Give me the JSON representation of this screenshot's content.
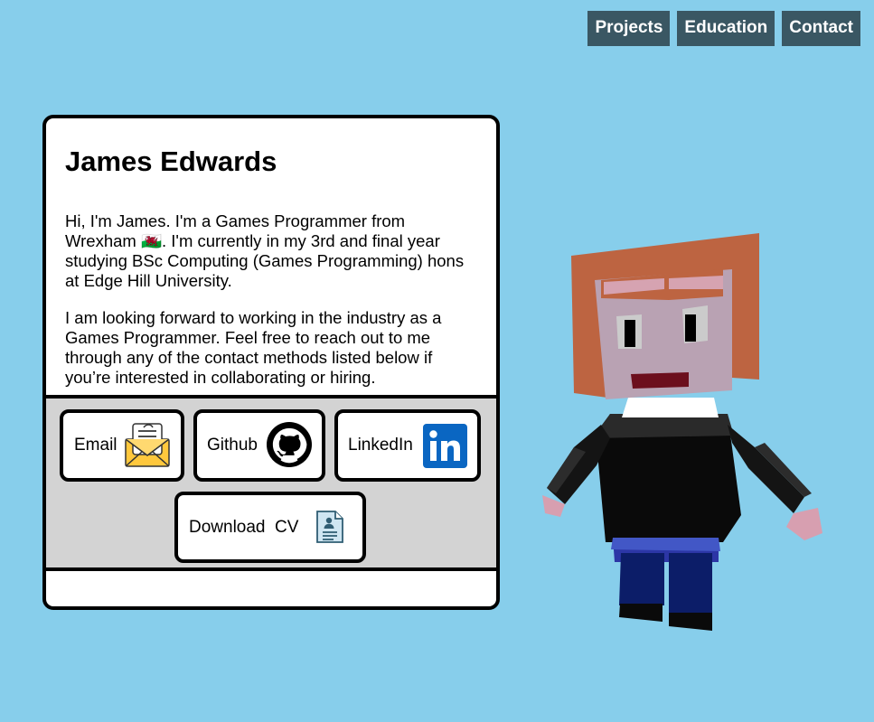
{
  "nav": {
    "items": [
      {
        "label": "Projects"
      },
      {
        "label": "Education"
      },
      {
        "label": "Contact"
      }
    ]
  },
  "card": {
    "name": "James Edwards",
    "para1": "Hi, I'm James. I'm a Games Programmer from Wrexham 🏴󠁧󠁢󠁷󠁬󠁳󠁿. I'm currently in my 3rd and final year studying BSc Computing (Games Programming) hons at Edge Hill University.",
    "para2": "I am looking forward to working in the industry as a Games Programmer. Feel free to reach out to me through any of the contact methods listed below if you’re interested in collaborating or hiring."
  },
  "contacts": {
    "email_label": "Email",
    "github_label": "Github",
    "linkedin_label": "LinkedIn",
    "cv_label": "Download  CV"
  },
  "icons": {
    "email": "envelope-letter-icon",
    "github": "github-octocat-icon",
    "linkedin": "linkedin-logo-icon",
    "cv": "resume-document-icon"
  },
  "colors": {
    "background": "#87ceeb",
    "nav_bg": "#3a5763",
    "linkedin": "#0a66c2",
    "panel_gray": "#d3d3d3"
  }
}
